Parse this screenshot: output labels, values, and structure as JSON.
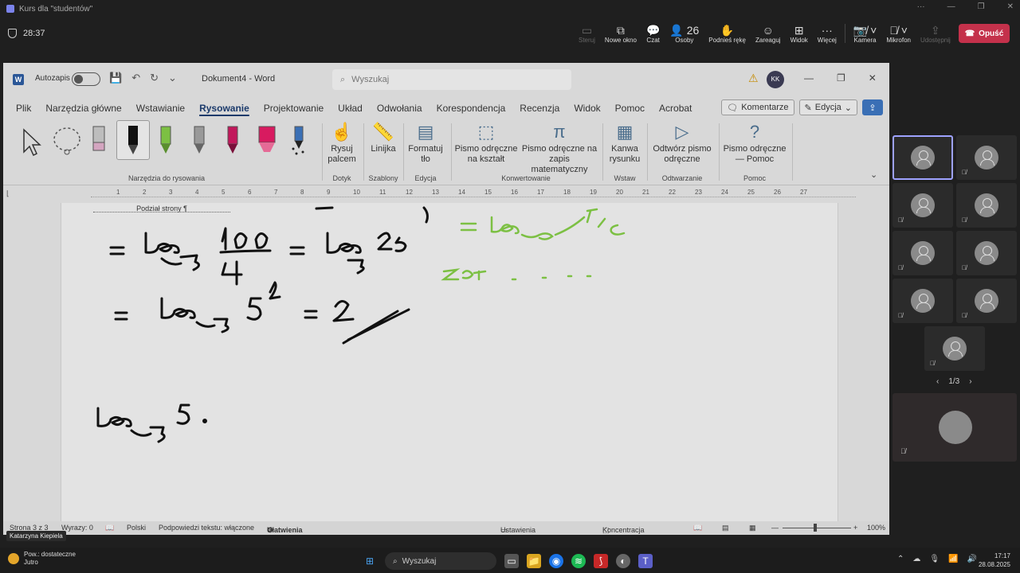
{
  "window": {
    "title": "Kurs dla \"studentów\""
  },
  "meeting": {
    "timer": "28:37",
    "tools": [
      {
        "icon": "screen-share-icon",
        "glyph": "▭",
        "label": "Steruj",
        "enabled": false
      },
      {
        "icon": "new-window-icon",
        "glyph": "⧉",
        "label": "Nowe okno",
        "enabled": true
      },
      {
        "icon": "chat-icon",
        "glyph": "💬",
        "label": "Czat",
        "enabled": true
      },
      {
        "icon": "people-icon",
        "glyph": "👤 26",
        "label": "Osoby",
        "enabled": true
      },
      {
        "icon": "raise-hand-icon",
        "glyph": "✋",
        "label": "Podnieś rękę",
        "enabled": true
      },
      {
        "icon": "react-icon",
        "glyph": "☺",
        "label": "Zareaguj",
        "enabled": true
      },
      {
        "icon": "view-icon",
        "glyph": "⊞",
        "label": "Widok",
        "enabled": true
      },
      {
        "icon": "more-icon",
        "glyph": "···",
        "label": "Więcej",
        "enabled": true
      },
      {
        "icon": "camera-icon",
        "glyph": "📷̸ ˅",
        "label": "Kamera",
        "enabled": true
      },
      {
        "icon": "mic-icon",
        "glyph": "🎙̸ ˅",
        "label": "Mikrofon",
        "enabled": true
      },
      {
        "icon": "share-icon",
        "glyph": "⇪",
        "label": "Udostępnij",
        "enabled": false
      }
    ],
    "leave_label": "Opuść",
    "participants_count": "26"
  },
  "word": {
    "autosave_label": "Autozapis",
    "doc_name": "Dokument4",
    "app_name": "Word",
    "search_placeholder": "Wyszukaj",
    "avatar_initials": "KK",
    "tabs": [
      "Plik",
      "Narzędzia główne",
      "Wstawianie",
      "Rysowanie",
      "Projektowanie",
      "Układ",
      "Odwołania",
      "Korespondencja",
      "Recenzja",
      "Widok",
      "Pomoc",
      "Acrobat"
    ],
    "active_tab": "Rysowanie",
    "comments_label": "Komentarze",
    "edit_label": "Edycja",
    "ribbon": {
      "group_drawing_tools": "Narzędzia do rysowania",
      "draw_finger": "Rysuj palcem",
      "group_touch": "Dotyk",
      "ruler": "Linijka",
      "group_templates": "Szablony",
      "format_bg": "Formatuj tło",
      "group_edit": "Edycja",
      "ink_to_shape": "Pismo odręczne na kształt",
      "ink_to_math": "Pismo odręczne na zapis matematyczny",
      "group_convert": "Konwertowanie",
      "canvas": "Kanwa rysunku",
      "group_insert": "Wstaw",
      "replay": "Odtwórz pismo odręczne",
      "group_replay": "Odtwarzanie",
      "ink_help": "Pismo odręczne — Pomoc",
      "group_help": "Pomoc"
    },
    "ruler_ticks": [
      "1",
      "2",
      "3",
      "4",
      "5",
      "6",
      "7",
      "8",
      "9",
      "10",
      "11",
      "12",
      "13",
      "14",
      "15",
      "16",
      "17",
      "18",
      "19",
      "20",
      "21",
      "22",
      "23",
      "24",
      "25",
      "26",
      "27"
    ],
    "page_break": "Podział strony",
    "status": {
      "page": "Strona 3 z 3",
      "words": "Wyrazy: 0",
      "language": "Polski",
      "predictions": "Podpowiedzi tekstu: włączone",
      "accessibility": "Ułatwienia dostępu: zbadaj",
      "display_settings": "Ustawienia wyświetlania",
      "focus": "Koncentracja uwagi",
      "zoom": "100%"
    }
  },
  "tooltip": "Katarzyna Kiepiela",
  "gallery": {
    "pager": "1/3"
  },
  "taskbar": {
    "weather_line1": "Pow.: dostateczne",
    "weather_line2": "Jutro",
    "search_placeholder": "Wyszukaj",
    "time": "17:17",
    "date": "28.08.2025"
  }
}
